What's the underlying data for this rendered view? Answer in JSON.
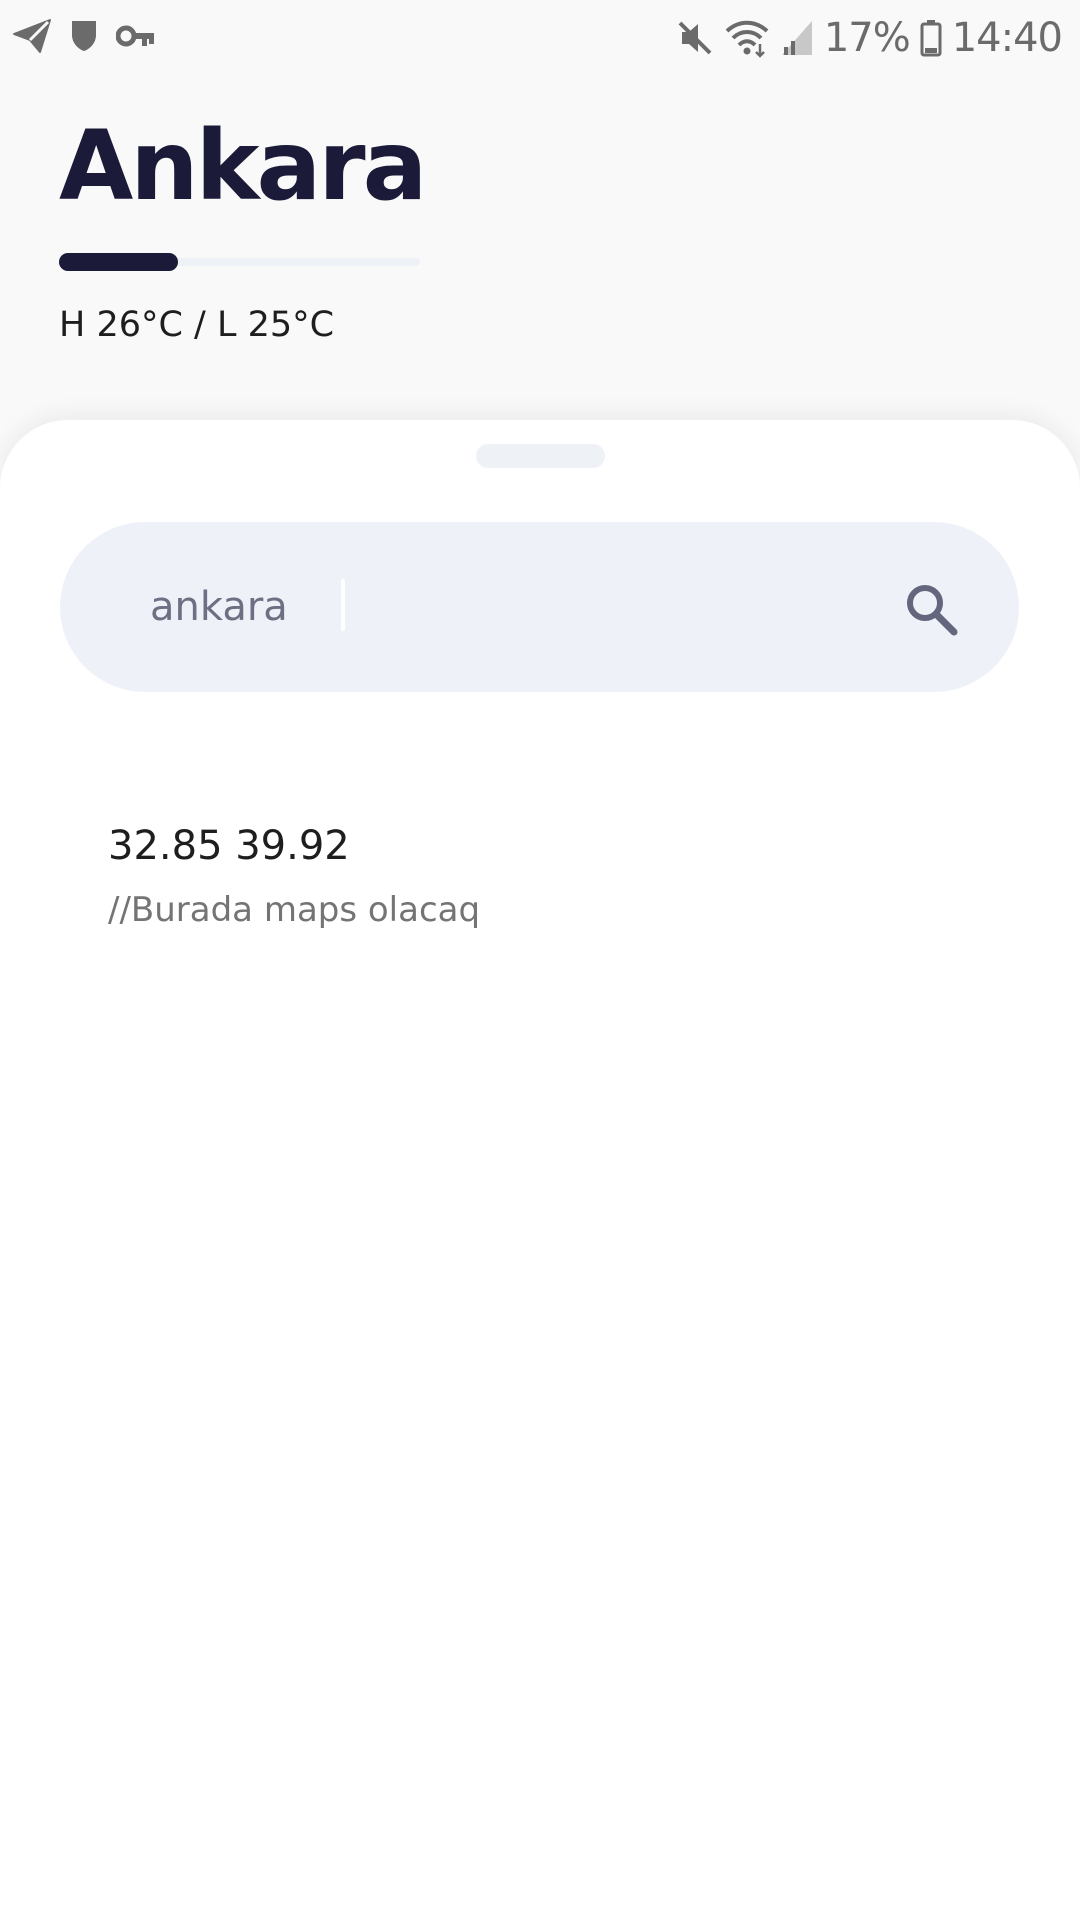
{
  "status_bar": {
    "icons_left": [
      "send-icon",
      "shield-icon",
      "key-icon"
    ],
    "icons_right": [
      "mute-icon",
      "wifi-icon",
      "signal-icon",
      "battery-icon"
    ],
    "battery": "17%",
    "time": "14:40"
  },
  "header": {
    "city": "Ankara",
    "temp_range": "H 26°C / L 25°C",
    "progress": 0.33
  },
  "sheet": {
    "search": {
      "value": "ankara",
      "icon": "search-icon"
    },
    "result": {
      "coordinates": "32.85 39.92",
      "note": "//Burada maps olacaq"
    }
  },
  "colors": {
    "title": "#1b1a38",
    "search_bg": "#eef2f8",
    "sheet_bg": "#ffffff",
    "page_bg": "#f9f9f9"
  }
}
